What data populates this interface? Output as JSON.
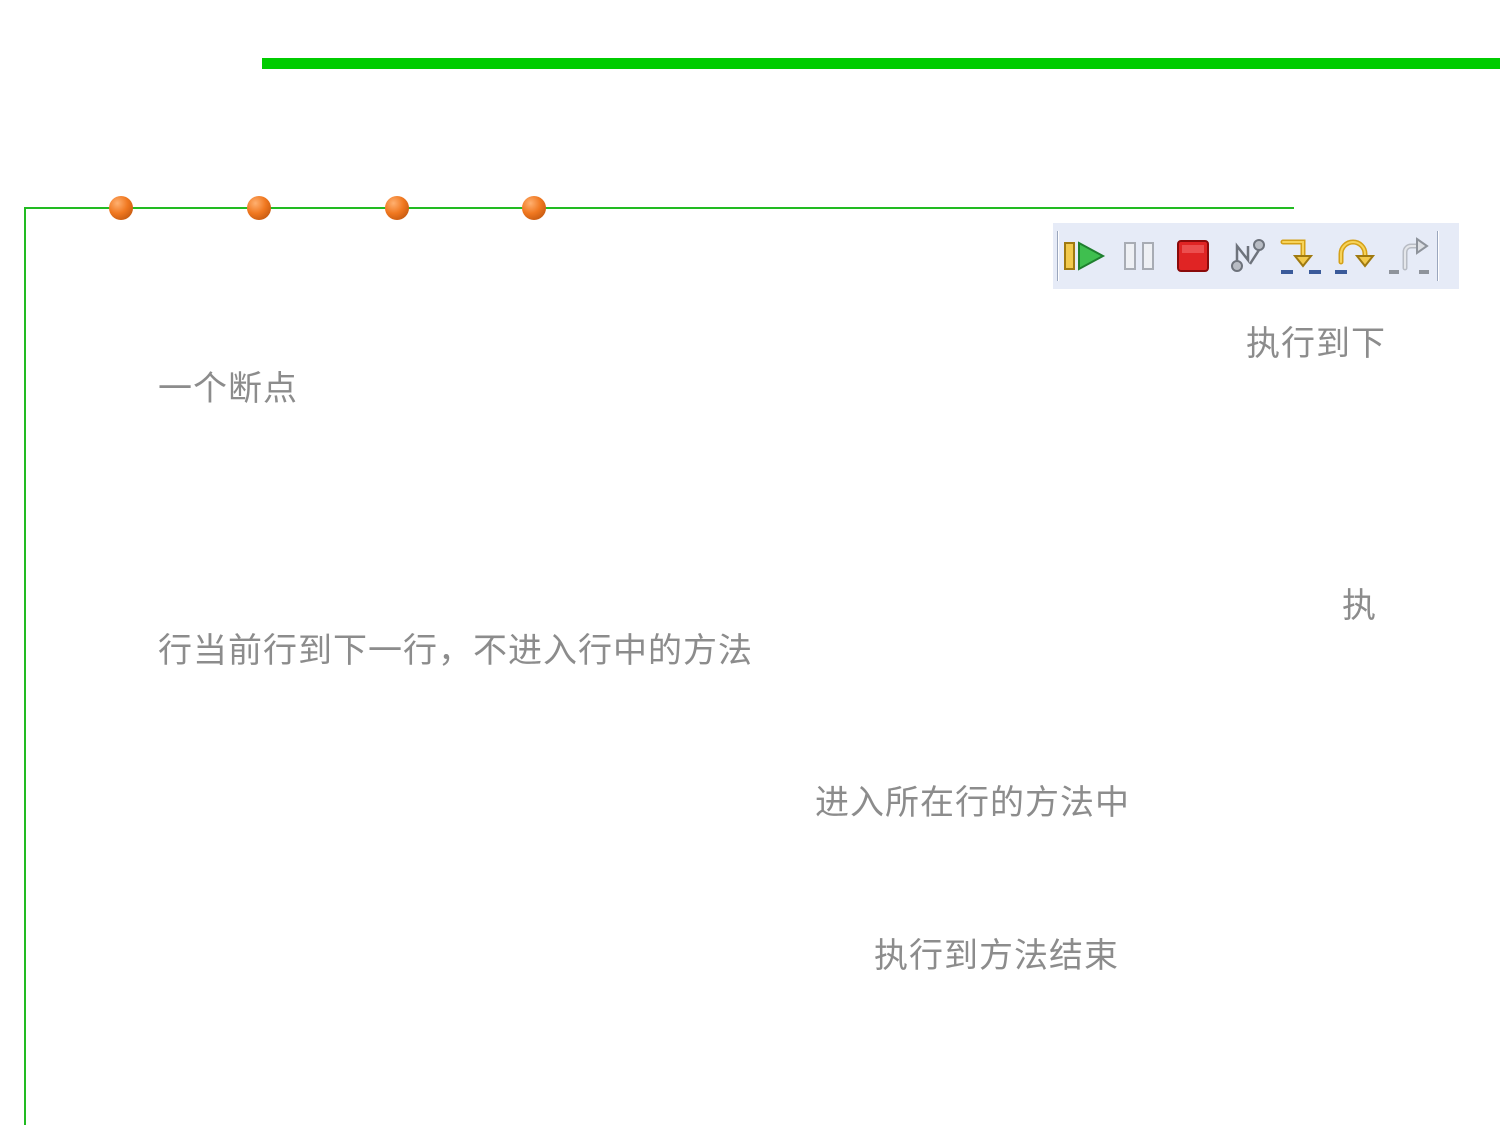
{
  "colors": {
    "accent_bar": "#00cc00",
    "frame_line": "#22bb22",
    "bullet": "#f07820",
    "toolbar_bg": "#e6ebf7",
    "text": "#8c8c8c"
  },
  "toolbar": {
    "buttons": [
      {
        "name": "resume-icon"
      },
      {
        "name": "suspend-icon"
      },
      {
        "name": "terminate-icon"
      },
      {
        "name": "disconnect-icon"
      },
      {
        "name": "step-into-icon"
      },
      {
        "name": "step-over-icon"
      },
      {
        "name": "step-return-icon"
      }
    ]
  },
  "descriptions": {
    "resume_part1": "执行到下",
    "resume_part2": "一个断点",
    "step_over_part1": "执",
    "step_over_part2": "行当前行到下一行，不进入行中的方法",
    "step_into": "进入所在行的方法中",
    "step_return": "执行到方法结束"
  }
}
